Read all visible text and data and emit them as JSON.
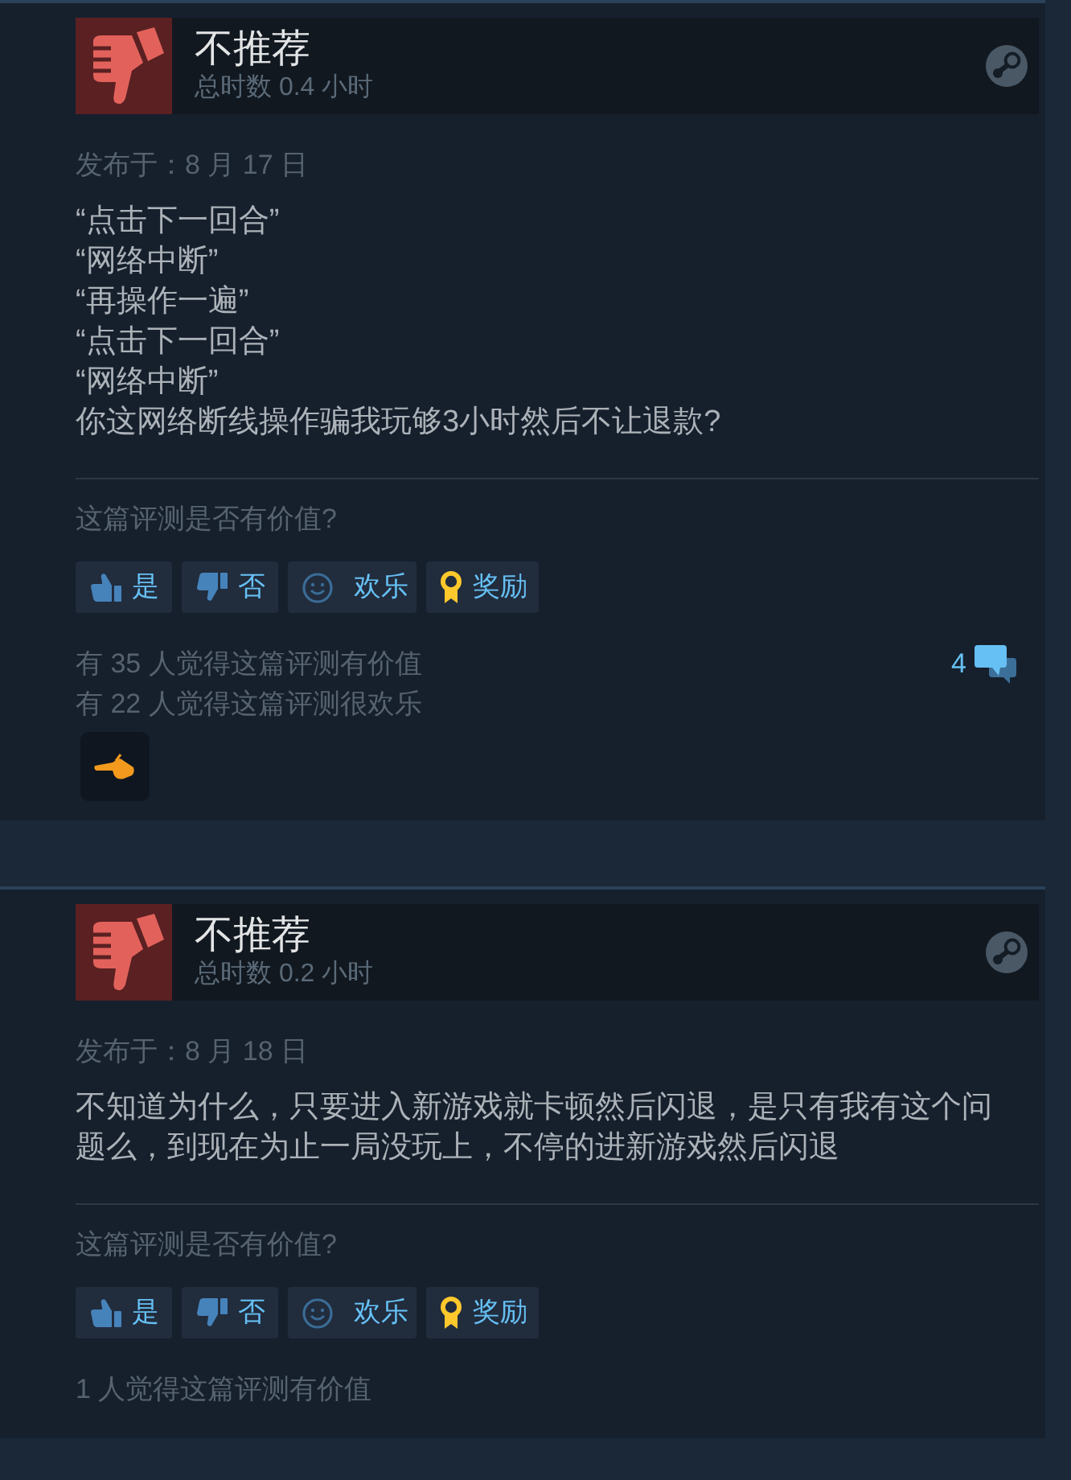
{
  "reviews": [
    {
      "recommended": false,
      "verdict": "不推荐",
      "playtime": "总时数 0.4 小时",
      "posted": "发布于：8 月 17 日",
      "body_lines": [
        "“点击下一回合”",
        "“网络中断”",
        "“再操作一遍”",
        "“点击下一回合”",
        "“网络中断”",
        "你这网络断线操作骗我玩够3小时然后不让退款?"
      ],
      "helpful_prompt": "这篇评测是否有价值?",
      "vote_buttons": [
        {
          "kind": "yes",
          "label": "是"
        },
        {
          "kind": "no",
          "label": "否"
        },
        {
          "kind": "funny",
          "label": "欢乐"
        },
        {
          "kind": "award",
          "label": "奖励"
        }
      ],
      "stats": [
        "有 35 人觉得这篇评测有价值",
        "有 22 人觉得这篇评测很欢乐"
      ],
      "comment_count": "4",
      "has_award": true
    },
    {
      "recommended": false,
      "verdict": "不推荐",
      "playtime": "总时数 0.2 小时",
      "posted": "发布于：8 月 18 日",
      "body_lines": [
        "不知道为什么，只要进入新游戏就卡顿然后闪退，是只有我有这个问题么，到现在为止一局没玩上，不停的进新游戏然后闪退"
      ],
      "helpful_prompt": "这篇评测是否有价值?",
      "vote_buttons": [
        {
          "kind": "yes",
          "label": "是"
        },
        {
          "kind": "no",
          "label": "否"
        },
        {
          "kind": "funny",
          "label": "欢乐"
        },
        {
          "kind": "award",
          "label": "奖励"
        }
      ],
      "stats": [
        "1 人觉得这篇评测有价值"
      ],
      "has_award": false
    }
  ]
}
